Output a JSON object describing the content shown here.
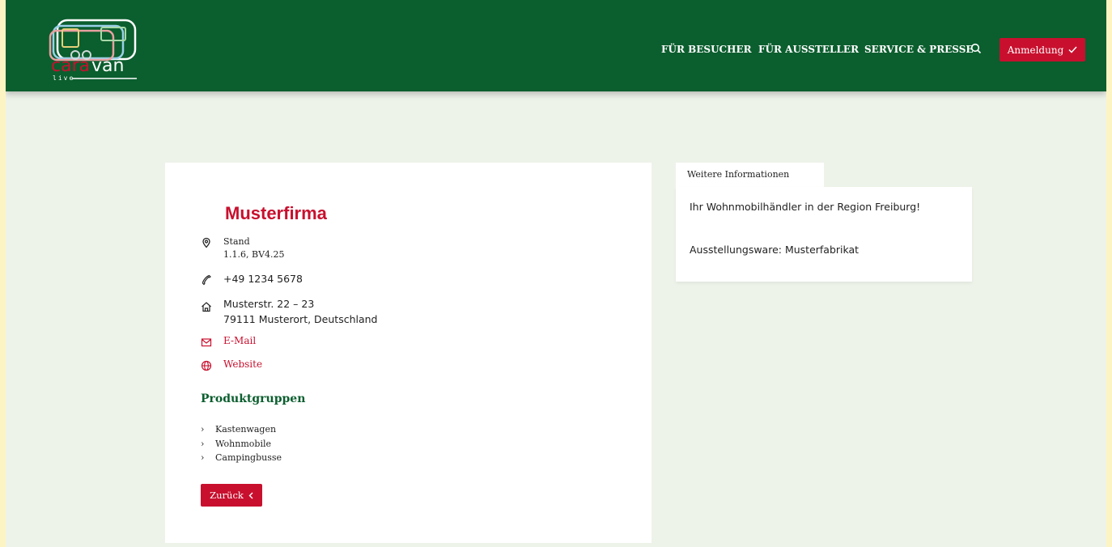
{
  "header": {
    "logo": {
      "text": "caravan",
      "sub": "live"
    },
    "nav": [
      {
        "label": "FÜR BESUCHER"
      },
      {
        "label": "FÜR AUSSTELLER"
      },
      {
        "label": "SERVICE & PRESSE"
      }
    ],
    "login_label": "Anmeldung",
    "search_icon": "search-icon"
  },
  "exhibitor": {
    "name": "Musterfirma",
    "stand_label": "Stand",
    "stand_value": "1.1.6, BV4.25",
    "phone": "+49 1234 5678",
    "address_line1": "Musterstr. 22 – 23",
    "address_line2": "79111 Musterort, Deutschland",
    "email_label": "E-Mail",
    "website_label": "Website"
  },
  "product_groups": {
    "title": "Produktgruppen",
    "items": [
      "Kastenwagen",
      "Wohnmobile",
      "Campingbusse"
    ]
  },
  "back_label": "Zurück",
  "info_panel": {
    "tab_label": "Weitere Informationen",
    "line1": "Ihr Wohnmobilhändler in der Region Freiburg!",
    "line2": "Ausstellungsware: Musterfabrikat"
  },
  "colors": {
    "brand_green": "#0b5e2e",
    "accent_red": "#c8102e",
    "page_bg": "#eef3ea"
  }
}
